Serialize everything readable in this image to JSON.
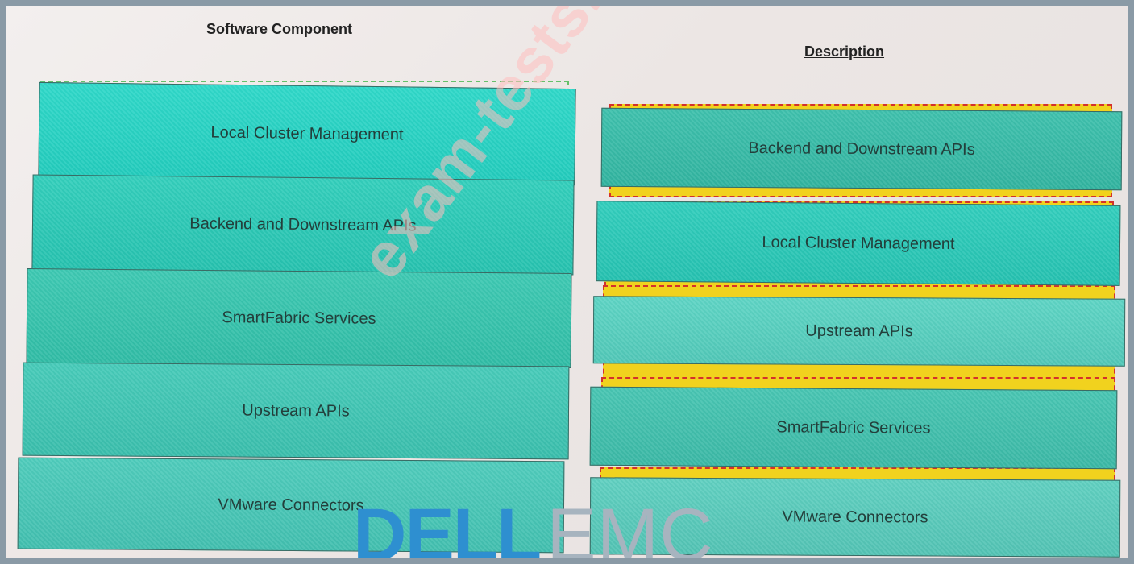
{
  "headings": {
    "software_component": "Software Component",
    "description": "Description"
  },
  "left_column": {
    "items": [
      "Local Cluster Management",
      "Backend and Downstream APIs",
      "SmartFabric Services",
      "Upstream APIs",
      "VMware Connectors"
    ]
  },
  "right_column": {
    "items": [
      "Backend and Downstream APIs",
      "Local Cluster Management",
      "Upstream APIs",
      "SmartFabric Services",
      "VMware Connectors"
    ]
  },
  "watermark": "exam-tests.com",
  "logo": {
    "dell": "DELL",
    "emc": "EMC"
  },
  "colors": {
    "tile": "#2ec4b2",
    "drop_zone_left": "#67c06a",
    "drop_zone_right": "#d4312b",
    "drop_zone_fill": "#f1d21e",
    "dell_blue": "#2e8fd0",
    "frame_border": "#8a9aa6"
  }
}
